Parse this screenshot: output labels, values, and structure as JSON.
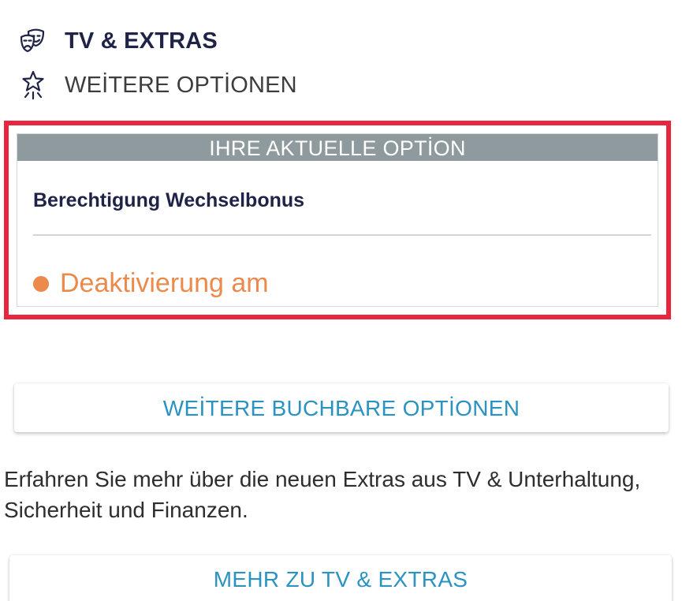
{
  "nav": {
    "tv_extras": {
      "label": "TV & EXTRAS",
      "icon": "theater-masks-icon"
    },
    "weitere_optionen": {
      "label": "WEİTERE OPTİONEN",
      "icon": "star-sparkle-icon"
    }
  },
  "current_option": {
    "header": "IHRE AKTUELLE OPTİON",
    "title": "Berechtigung Wechselbonus",
    "status": "Deaktivierung am",
    "status_color": "#ec8a4c",
    "highlight_color": "#e8263f"
  },
  "buttons": {
    "more_options": "WEİTERE BUCHBARE OPTİONEN",
    "more_tv_extras": "MEHR ZU TV & EXTRAS"
  },
  "info": {
    "text": "Erfahren Sie mehr über die neuen Extras aus TV & Unterhaltung, Sicherheit und Finanzen."
  },
  "colors": {
    "navy": "#1f2347",
    "header_gray": "#8e9a9d",
    "link_blue": "#2b93c2"
  }
}
